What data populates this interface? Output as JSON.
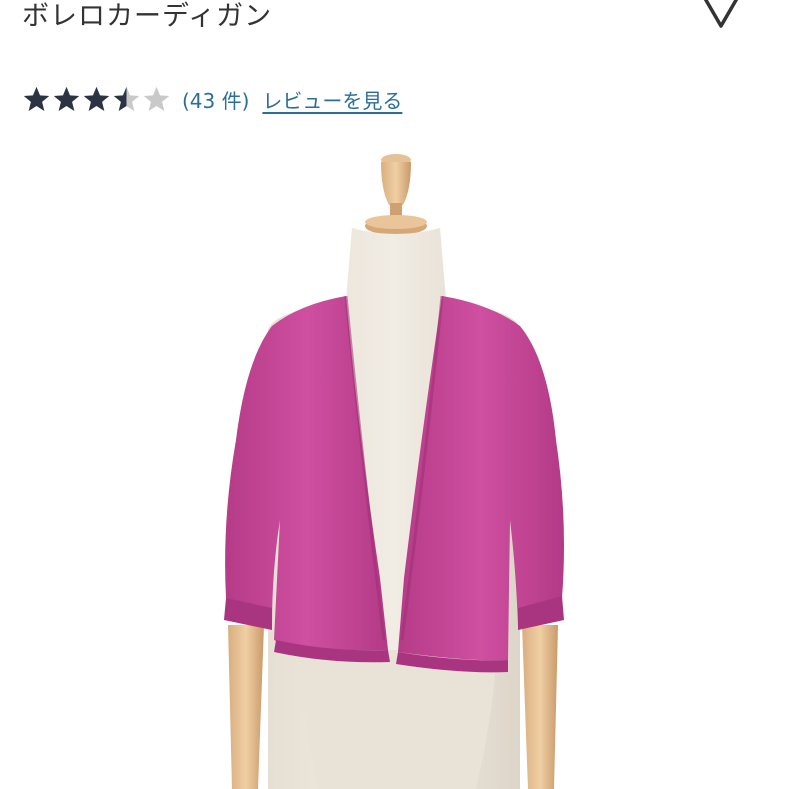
{
  "product": {
    "title": "ボレロカーディガン"
  },
  "favorite": {
    "icon": "heart-outline-icon",
    "color": "#333333"
  },
  "rating": {
    "value": 3.5,
    "max": 5,
    "count_text": "(43 件)",
    "review_link_label": "レビューを見る",
    "star_filled_color": "#2c3444",
    "star_empty_color": "#c9c9c9"
  },
  "image": {
    "subject": "magenta-bolero-cardigan-on-mannequin",
    "garment_color": "#c8489a",
    "background_color": "#ffffff"
  },
  "colors": {
    "link": "#2b6e98",
    "text": "#333333"
  }
}
